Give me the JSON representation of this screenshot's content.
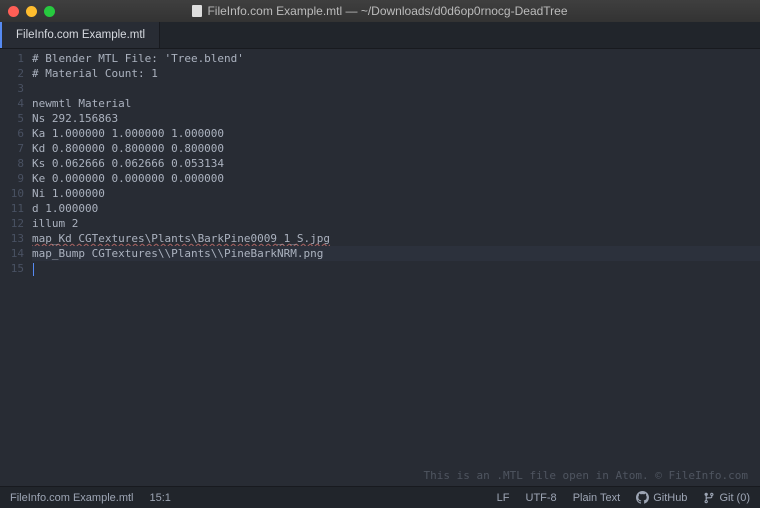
{
  "titlebar": {
    "title": "FileInfo.com Example.mtl — ~/Downloads/d0d6op0rnocg-DeadTree"
  },
  "tabs": [
    {
      "label": "FileInfo.com Example.mtl"
    }
  ],
  "lines": [
    "# Blender MTL File: 'Tree.blend'",
    "# Material Count: 1",
    "",
    "newmtl Material",
    "Ns 292.156863",
    "Ka 1.000000 1.000000 1.000000",
    "Kd 0.800000 0.800000 0.800000",
    "Ks 0.062666 0.062666 0.053134",
    "Ke 0.000000 0.000000 0.000000",
    "Ni 1.000000",
    "d 1.000000",
    "illum 2",
    "map_Kd CGTextures\\Plants\\BarkPine0009_1_S.jpg",
    "map_Bump CGTextures\\\\Plants\\\\PineBarkNRM.png",
    ""
  ],
  "watermark": "This is an .MTL file open in Atom. © FileInfo.com",
  "status": {
    "file": "FileInfo.com Example.mtl",
    "cursor": "15:1",
    "lineEnding": "LF",
    "encoding": "UTF-8",
    "grammar": "Plain Text",
    "github": "GitHub",
    "git": "Git (0)"
  }
}
